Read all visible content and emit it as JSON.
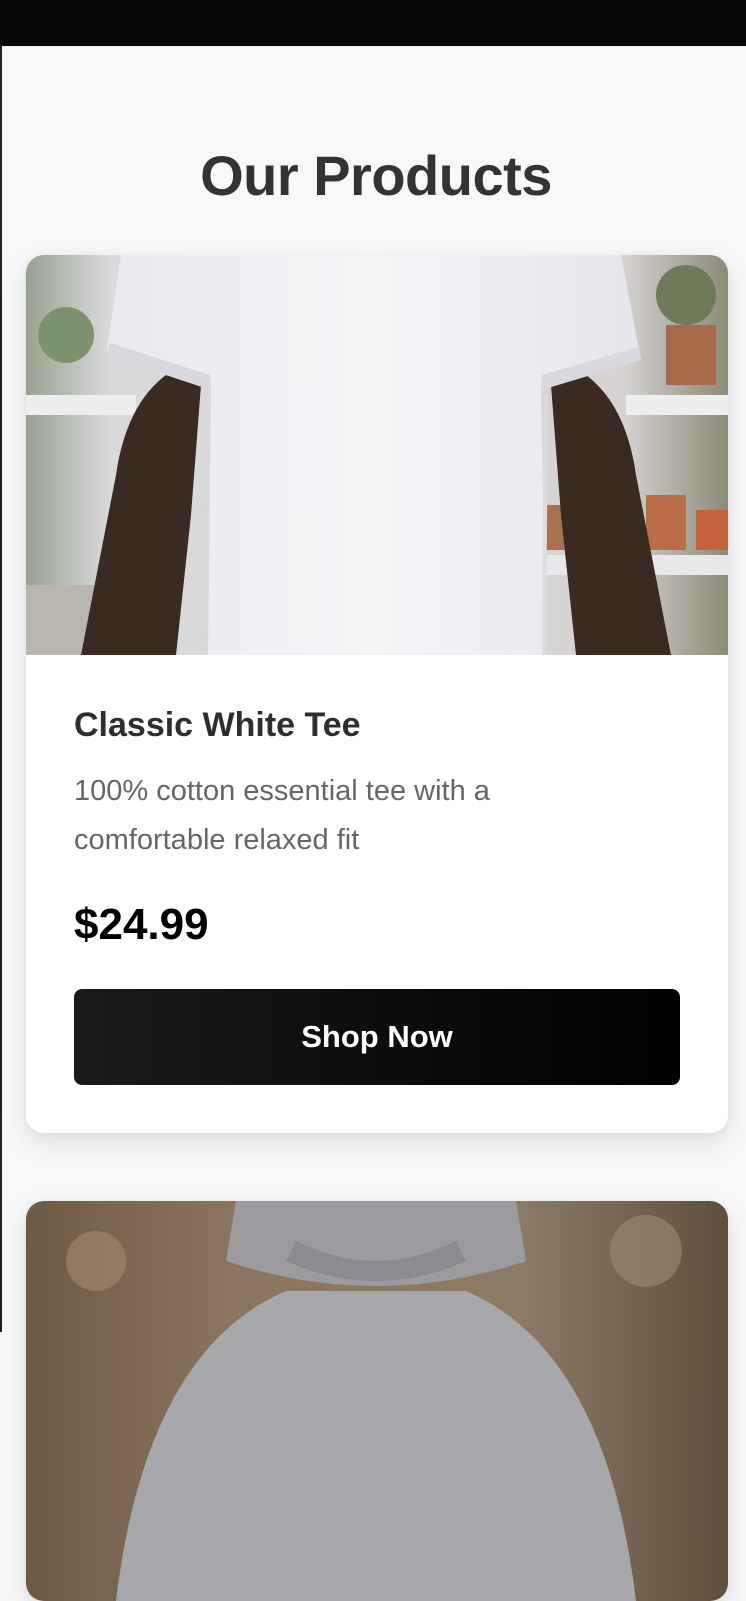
{
  "page": {
    "title": "Our Products"
  },
  "products": [
    {
      "name": "Classic White Tee",
      "description": "100% cotton essential tee with a comfortable relaxed fit",
      "price": "$24.99",
      "button_label": "Shop Now",
      "image": "white-tshirt-photo"
    },
    {
      "image": "grey-hoodie-photo"
    }
  ],
  "colors": {
    "background": "#f7f8fa",
    "top_bar": "#060607",
    "button": "#000000",
    "button_text": "#ffffff",
    "title": "#333333",
    "description": "#666666"
  }
}
